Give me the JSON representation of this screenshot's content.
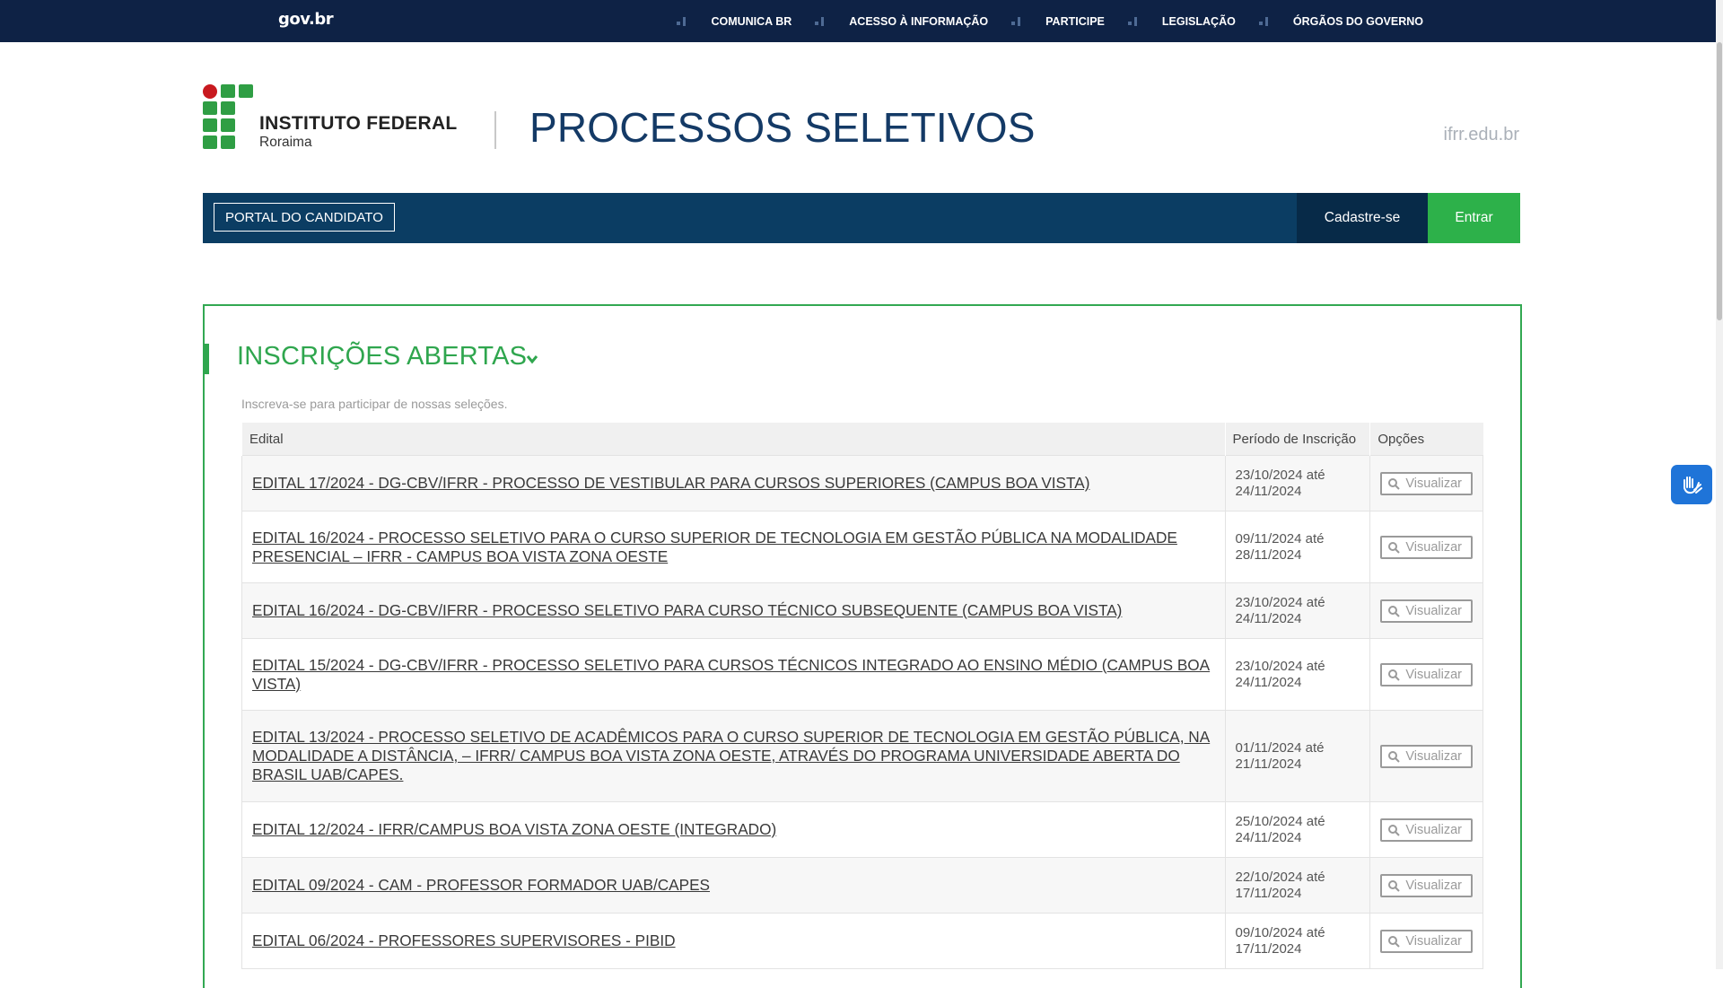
{
  "govbar": {
    "logo": "gov.br",
    "links": [
      "COMUNICA BR",
      "ACESSO À INFORMAÇÃO",
      "PARTICIPE",
      "LEGISLAÇÃO",
      "ÓRGÃOS DO GOVERNO"
    ]
  },
  "header": {
    "institution_name": "INSTITUTO FEDERAL",
    "institution_sub": "Roraima",
    "title": "PROCESSOS SELETIVOS",
    "site_link": "ifrr.edu.br"
  },
  "nav": {
    "portal": "PORTAL DO CANDIDATO",
    "cadastre": "Cadastre-se",
    "entrar": "Entrar"
  },
  "section": {
    "title": "INSCRIÇÕES ABERTAS",
    "subtitle": "Inscreva-se para participar de nossas seleções."
  },
  "table": {
    "headers": [
      "Edital",
      "Período de Inscrição",
      "Opções"
    ],
    "button_label": "Visualizar",
    "rows": [
      {
        "edital": "EDITAL 17/2024 - DG-CBV/IFRR - PROCESSO DE VESTIBULAR PARA CURSOS SUPERIORES (CAMPUS BOA VISTA)",
        "inicio": "23/10/2024 até",
        "fim": "24/11/2024"
      },
      {
        "edital": "EDITAL 16/2024 - PROCESSO SELETIVO PARA O CURSO SUPERIOR DE TECNOLOGIA EM GESTÃO PÚBLICA NA MODALIDADE PRESENCIAL – IFRR - CAMPUS BOA VISTA ZONA OESTE",
        "inicio": "09/11/2024 até",
        "fim": "28/11/2024"
      },
      {
        "edital": "EDITAL 16/2024 - DG-CBV/IFRR - PROCESSO SELETIVO PARA CURSO TÉCNICO SUBSEQUENTE (CAMPUS BOA VISTA)",
        "inicio": "23/10/2024 até",
        "fim": "24/11/2024"
      },
      {
        "edital": "EDITAL 15/2024 - DG-CBV/IFRR - PROCESSO SELETIVO PARA CURSOS TÉCNICOS INTEGRADO AO ENSINO MÉDIO (CAMPUS BOA VISTA)",
        "inicio": "23/10/2024 até",
        "fim": "24/11/2024"
      },
      {
        "edital": "EDITAL 13/2024 - PROCESSO SELETIVO DE ACADÊMICOS PARA O CURSO SUPERIOR DE TECNOLOGIA EM GESTÃO PÚBLICA, NA MODALIDADE A DISTÂNCIA, – IFRR/ CAMPUS BOA VISTA ZONA OESTE, ATRAVÉS DO PROGRAMA UNIVERSIDADE ABERTA DO BRASIL UAB/CAPES.",
        "inicio": "01/11/2024 até",
        "fim": "21/11/2024"
      },
      {
        "edital": "EDITAL 12/2024 - IFRR/CAMPUS BOA VISTA ZONA OESTE (INTEGRADO)",
        "inicio": "25/10/2024 até",
        "fim": "24/11/2024"
      },
      {
        "edital": "EDITAL 09/2024 - CAM - PROFESSOR FORMADOR UAB/CAPES",
        "inicio": "22/10/2024 até",
        "fim": "17/11/2024"
      },
      {
        "edital": "EDITAL 06/2024 - PROFESSORES SUPERVISORES - PIBID",
        "inicio": "09/10/2024 até",
        "fim": "17/11/2024"
      }
    ]
  }
}
